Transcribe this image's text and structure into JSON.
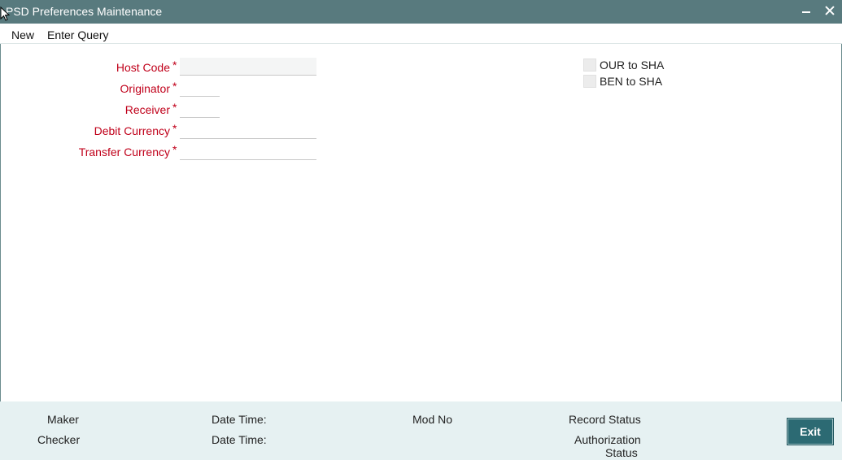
{
  "window": {
    "title": "PSD Preferences Maintenance",
    "minimize_icon": "minimize-icon",
    "close_icon": "close-icon"
  },
  "menu": {
    "new_label": "New",
    "enter_query_label": "Enter Query"
  },
  "form": {
    "required_marker": "*",
    "host_code": {
      "label": "Host Code",
      "value": ""
    },
    "originator": {
      "label": "Originator",
      "value": ""
    },
    "receiver": {
      "label": "Receiver",
      "value": ""
    },
    "debit_currency": {
      "label": "Debit Currency",
      "value": ""
    },
    "transfer_currency": {
      "label": "Transfer Currency",
      "value": ""
    }
  },
  "options": {
    "our_to_sha": {
      "label": "OUR to SHA",
      "checked": false
    },
    "ben_to_sha": {
      "label": "BEN to SHA",
      "checked": false
    }
  },
  "footer": {
    "maker": "Maker",
    "checker": "Checker",
    "date_time_1": "Date Time:",
    "date_time_2": "Date Time:",
    "mod_no": "Mod No",
    "record_status": "Record Status",
    "authorization_status_line1": "Authorization",
    "authorization_status_line2": "Status",
    "exit_label": "Exit"
  },
  "colors": {
    "titlebar": "#587a7e",
    "required_label": "#c0001a",
    "footer_bg": "#e6f1f2",
    "exit_button": "#2c6a73"
  }
}
